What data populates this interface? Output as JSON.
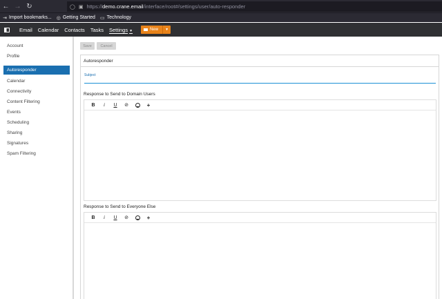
{
  "browser": {
    "url_proto": "https://",
    "url_host": "demo.crane.email",
    "url_path": "/interface/root#/settings/user/auto-responder",
    "bookmarks": [
      {
        "label": "Import bookmarks...",
        "icon": "import-icon"
      },
      {
        "label": "Getting Started",
        "icon": "globe-icon"
      },
      {
        "label": "Technology",
        "icon": "folder-icon"
      }
    ]
  },
  "appbar": {
    "nav": [
      "Email",
      "Calendar",
      "Contacts",
      "Tasks",
      "Settings"
    ],
    "new_label": "New",
    "accent": "#e8831a"
  },
  "sidebar": {
    "items": [
      "Account",
      "Profile",
      "Autoresponder",
      "Calendar",
      "Connectivity",
      "Content Filtering",
      "Events",
      "Scheduling",
      "Sharing",
      "Signatures",
      "Spam Filtering"
    ],
    "active": "Autoresponder",
    "active_color": "#1a6fb0"
  },
  "toolbar": {
    "save_label": "Save",
    "cancel_label": "Cancel"
  },
  "form": {
    "header": "Autoresponder",
    "subject_label": "Subject",
    "subject_value": "",
    "section1": "Response to Send to Domain Users",
    "section2": "Response to Send to Everyone Else",
    "editor_tools": [
      "B",
      "I",
      "U",
      "S",
      "emoji",
      "+"
    ]
  }
}
